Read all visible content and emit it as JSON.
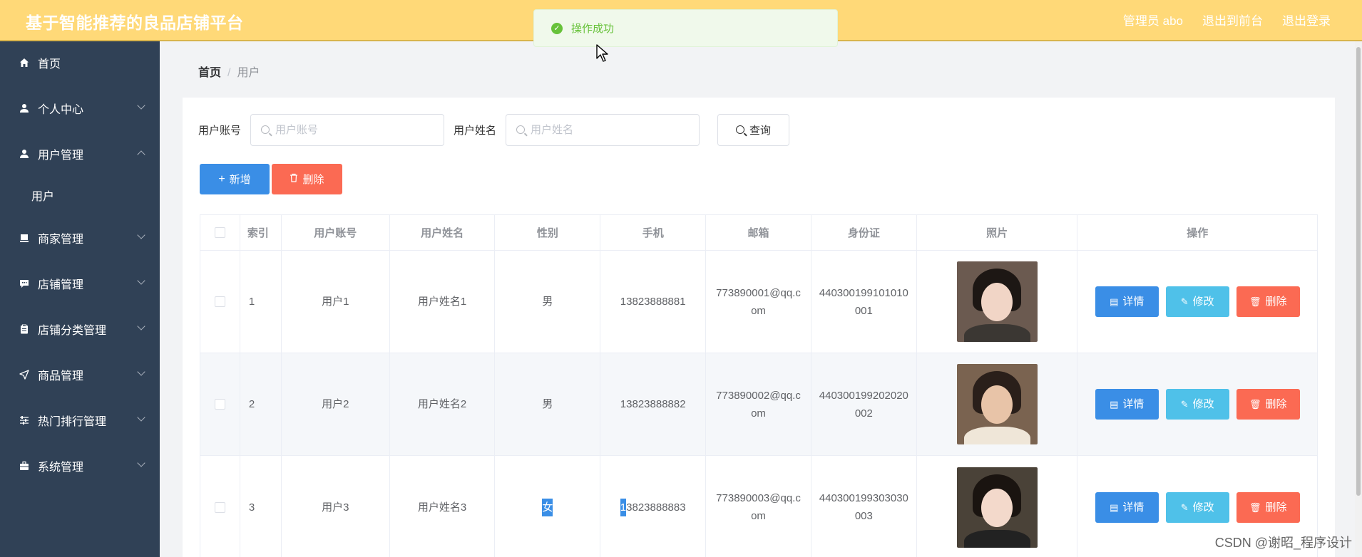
{
  "header": {
    "brand": "基于智能推荐的良品店铺平台",
    "admin": "管理员 abo",
    "to_front": "退出到前台",
    "logout": "退出登录"
  },
  "toast": {
    "message": "操作成功"
  },
  "sidebar": {
    "items": [
      {
        "label": "首页",
        "icon": "home-icon"
      },
      {
        "label": "个人中心",
        "icon": "user-icon"
      },
      {
        "label": "用户管理",
        "icon": "user-icon"
      },
      {
        "label": "商家管理",
        "icon": "shop-icon"
      },
      {
        "label": "店铺管理",
        "icon": "chat-icon"
      },
      {
        "label": "店铺分类管理",
        "icon": "clipboard-icon"
      },
      {
        "label": "商品管理",
        "icon": "send-icon"
      },
      {
        "label": "热门排行管理",
        "icon": "sliders-icon"
      },
      {
        "label": "系统管理",
        "icon": "briefcase-icon"
      }
    ],
    "sub_user": "用户"
  },
  "breadcrumb": {
    "home": "首页",
    "current": "用户"
  },
  "search": {
    "account_label": "用户账号",
    "account_placeholder": "用户账号",
    "name_label": "用户姓名",
    "name_placeholder": "用户姓名",
    "query_label": "查询"
  },
  "actions": {
    "add": "新增",
    "delete": "删除"
  },
  "table": {
    "headers": [
      "索引",
      "用户账号",
      "用户姓名",
      "性别",
      "手机",
      "邮箱",
      "身份证",
      "照片",
      "操作"
    ],
    "rows": [
      {
        "index": "1",
        "account": "用户1",
        "name": "用户姓名1",
        "gender": "男",
        "phone": "13823888881",
        "email": "773890001@qq.com",
        "idcard": "440300199101010001"
      },
      {
        "index": "2",
        "account": "用户2",
        "name": "用户姓名2",
        "gender": "男",
        "phone": "13823888882",
        "email": "773890002@qq.com",
        "idcard": "440300199202020002"
      },
      {
        "index": "3",
        "account": "用户3",
        "name": "用户姓名3",
        "gender": "女",
        "phone_first": "1",
        "phone_rest": "3823888883",
        "email": "773890003@qq.com",
        "idcard": "440300199303030003"
      }
    ],
    "row_actions": {
      "detail": "详情",
      "edit": "修改",
      "delete": "删除"
    }
  },
  "watermark": "CSDN @谢昭_程序设计",
  "colors": {
    "topbar": "#ffd978",
    "sidebar": "#304156",
    "primary": "#3a8ee6",
    "info": "#4fc1e9",
    "danger": "#fb6a53",
    "success": "#67c23a"
  }
}
